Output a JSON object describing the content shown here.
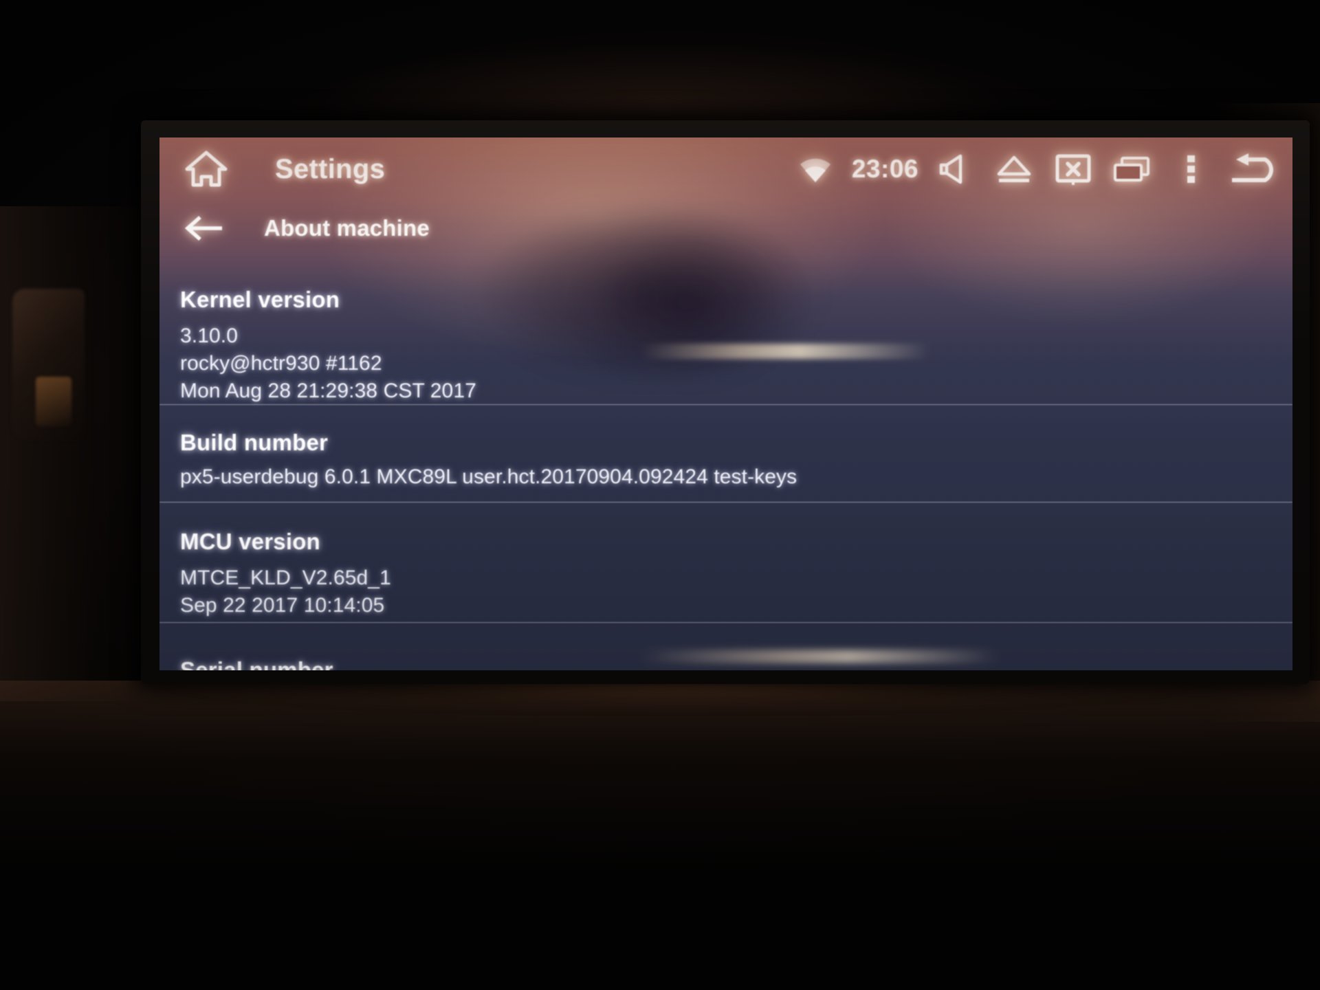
{
  "device": {
    "type": "android-car-head-unit",
    "screen_bg_top": "#8d4230",
    "screen_bg_bottom": "#6b7090",
    "text_color": "#ffffff"
  },
  "statusbar": {
    "home_icon": "home-icon",
    "app_title": "Settings",
    "wifi_icon": "wifi-icon",
    "clock": "23:06",
    "mute_icon": "volume-mute-icon",
    "eject_icon": "eject-icon",
    "screen_off_icon": "screen-off-icon",
    "recent_apps_icon": "recent-apps-icon",
    "overflow_icon": "overflow-menu-icon",
    "back_icon": "back-arrow-icon"
  },
  "subheader": {
    "back_icon": "arrow-left-icon",
    "title": "About machine"
  },
  "list": {
    "rows": [
      {
        "title": "Kernel version",
        "lines": [
          "3.10.0",
          "rocky@hctr930 #1162",
          "Mon Aug 28 21:29:38 CST 2017"
        ]
      },
      {
        "title": "Build number",
        "lines": [
          "px5-userdebug 6.0.1 MXC89L user.hct.20170904.092424 test-keys"
        ]
      },
      {
        "title": "MCU version",
        "lines": [
          "MTCE_KLD_V2.65d_1",
          "Sep 22 2017   10:14:05"
        ]
      },
      {
        "title": "Serial number",
        "lines": []
      }
    ]
  }
}
